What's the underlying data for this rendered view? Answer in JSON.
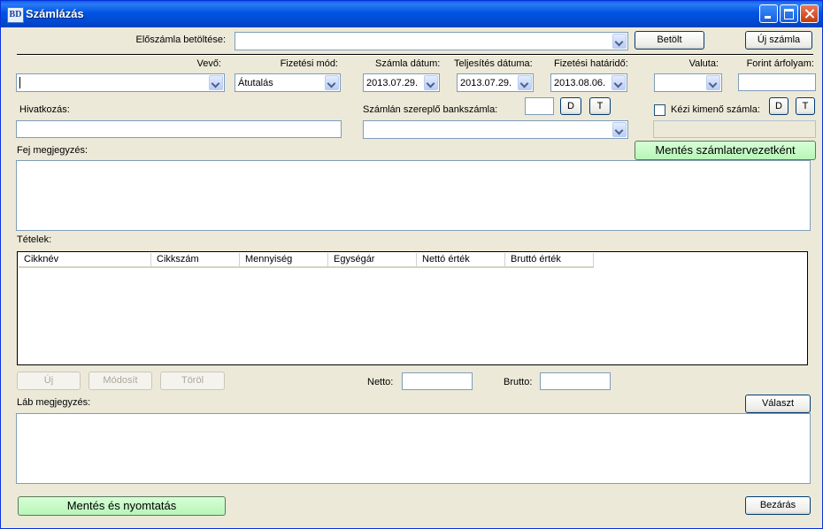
{
  "window": {
    "title": "Számlázás",
    "icon_text": "BD",
    "app_icon": "bd-app-icon",
    "controls": [
      "minimize-icon",
      "maximize-icon",
      "close-icon"
    ]
  },
  "preinvoice": {
    "label": "Előszámla betöltése:",
    "value": "",
    "load_button": "Betölt",
    "new_invoice_button": "Új számla"
  },
  "header_fields": {
    "buyer": {
      "label": "Vevő:",
      "value": ""
    },
    "payment_method": {
      "label": "Fizetési mód:",
      "value": "Átutalás"
    },
    "invoice_date": {
      "label": "Számla dátum:",
      "value": "2013.07.29."
    },
    "fulfillment_date": {
      "label": "Teljesítés dátuma:",
      "value": "2013.07.29."
    },
    "payment_deadline": {
      "label": "Fizetési határidő:",
      "value": "2013.08.06."
    },
    "currency": {
      "label": "Valuta:",
      "value": ""
    },
    "forint_rate": {
      "label": "Forint árfolyam:",
      "value": ""
    }
  },
  "reference": {
    "label": "Hivatkozás:",
    "value": ""
  },
  "bank_account": {
    "label": "Számlán szereplő bankszámla:",
    "value": "",
    "code_value": "",
    "d_button": "D",
    "t_button": "T"
  },
  "manual_invoice": {
    "label": "Kézi kimenő számla:",
    "checked": false,
    "d_button": "D",
    "t_button": "T",
    "value": ""
  },
  "save_draft_button": "Mentés számlatervezetként",
  "header_note": {
    "label": "Fej megjegyzés:",
    "value": ""
  },
  "items": {
    "label": "Tételek:",
    "columns": [
      "Cikknév",
      "Cikkszám",
      "Mennyiség",
      "Egységár",
      "Nettó érték",
      "Bruttó érték"
    ],
    "rows": []
  },
  "item_actions": {
    "new": "Új",
    "modify": "Módosít",
    "delete": "Töröl"
  },
  "totals": {
    "net_label": "Netto:",
    "net_value": "",
    "gross_label": "Brutto:",
    "gross_value": ""
  },
  "footer_note": {
    "label": "Láb megjegyzés:",
    "value": "",
    "choose_button": "Választ"
  },
  "save_print_button": "Mentés és nyomtatás",
  "close_button": "Bezárás",
  "colors": {
    "titlebar": "#0054e3",
    "face": "#ece9d8",
    "green_button": "#b8f5b8",
    "input_border": "#7f9db9"
  }
}
